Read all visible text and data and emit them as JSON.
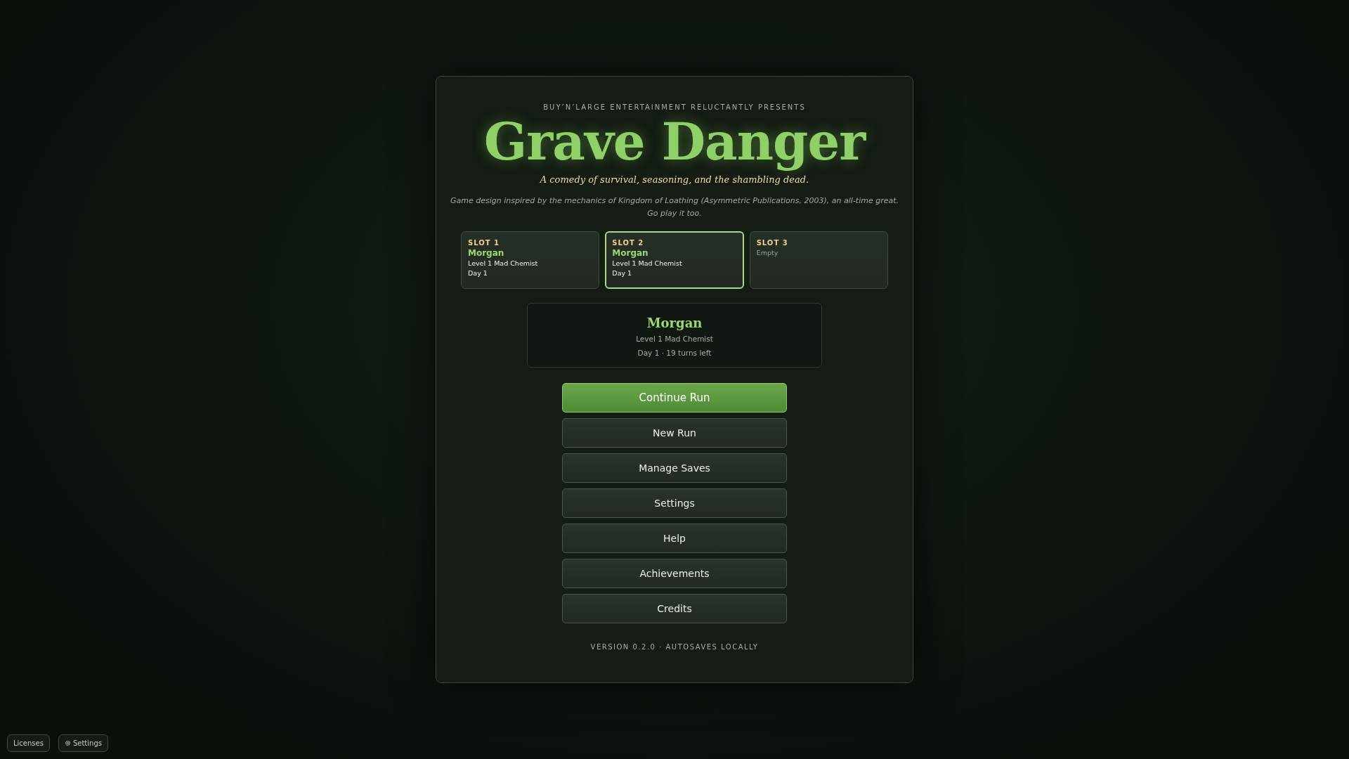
{
  "presenter": "BUY’N’LARGE ENTERTAINMENT RELUCTANTLY PRESENTS",
  "title": "Grave Danger",
  "tagline": "A comedy of survival, seasoning, and the shambling dead.",
  "credit": "Game design inspired by the mechanics of Kingdom of Loathing (Asymmetric Publications, 2003), an all-time great. Go play it too.",
  "slots": [
    {
      "label": "SLOT 1",
      "name": "Morgan",
      "lines": [
        "Level 1 Mad Chemist",
        "Day 1"
      ],
      "selected": false
    },
    {
      "label": "SLOT 2",
      "name": "Morgan",
      "lines": [
        "Level 1 Mad Chemist",
        "Day 1"
      ],
      "selected": true
    },
    {
      "label": "SLOT 3",
      "empty_text": "Empty",
      "selected": false
    }
  ],
  "summary": {
    "name": "Morgan",
    "lines": [
      "Level 1 Mad Chemist",
      "Day 1 · 19 turns left"
    ]
  },
  "buttons": [
    {
      "label": "Continue Run",
      "kind": "primary"
    },
    {
      "label": "New Run",
      "kind": "secondary"
    },
    {
      "label": "Manage Saves",
      "kind": "secondary"
    },
    {
      "label": "Settings",
      "kind": "secondary"
    },
    {
      "label": "Help",
      "kind": "secondary"
    },
    {
      "label": "Achievements",
      "kind": "secondary"
    },
    {
      "label": "Credits",
      "kind": "secondary"
    }
  ],
  "version": "VERSION 0.2.0 · AUTOSAVES LOCALLY",
  "footer_buttons": [
    {
      "label": "Licenses",
      "kind": "plain"
    },
    {
      "label": "Settings",
      "kind": "iconic"
    }
  ]
}
